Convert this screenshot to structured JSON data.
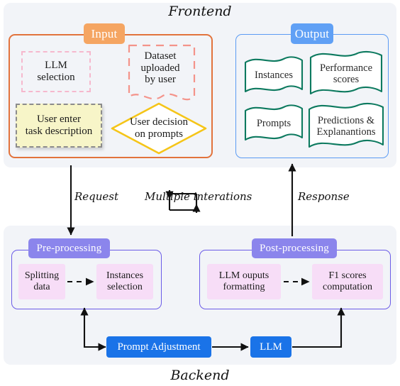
{
  "frontend": {
    "title": "Frontend",
    "input": {
      "badge": "Input",
      "llm_selection": "LLM\nselection",
      "llm_selection_line1": "LLM",
      "llm_selection_line2": "selection",
      "dataset_line1": "Dataset",
      "dataset_line2": "uploaded",
      "dataset_line3": "by user",
      "task_desc_line1": "User enter",
      "task_desc_line2": "task description",
      "decision_line1": "User decision",
      "decision_line2": "on prompts"
    },
    "output": {
      "badge": "Output",
      "flags": [
        {
          "label": "Instances"
        },
        {
          "label_line1": "Performance",
          "label_line2": "scores"
        },
        {
          "label": "Prompts"
        },
        {
          "label_line1": "Predictions &",
          "label_line2": "Explanantions"
        }
      ]
    }
  },
  "connectors": {
    "request": "Request",
    "response": "Response",
    "loop": "Multiple interations"
  },
  "backend": {
    "title": "Backend",
    "preprocessing": {
      "badge": "Pre-processing",
      "splitting_line1": "Splitting",
      "splitting_line2": "data",
      "instances_line1": "Instances",
      "instances_line2": "selection"
    },
    "postprocessing": {
      "badge": "Post-processing",
      "formatting_line1": "LLM ouputs",
      "formatting_line2": "formatting",
      "f1_line1": "F1 scores",
      "f1_line2": "computation"
    },
    "prompt_adjustment": "Prompt Adjustment",
    "llm": "LLM"
  },
  "colors": {
    "panel_bg": "#f2f4f8",
    "input_border": "#e2733c",
    "input_badge": "#f5a562",
    "output_border": "#5b9bf3",
    "output_badge": "#60a0f5",
    "processing_border": "#6b5ce7",
    "processing_badge": "#8b85ec",
    "pink_node": "#f7ddf7",
    "blue_node": "#1a73e8",
    "flag_stroke": "#0d7a5f",
    "diamond_stroke": "#f5c518",
    "dashed_pink": "#f6b8cd",
    "dashed_salmon": "#f4938a",
    "yellow_fill": "#f7f5c8"
  }
}
